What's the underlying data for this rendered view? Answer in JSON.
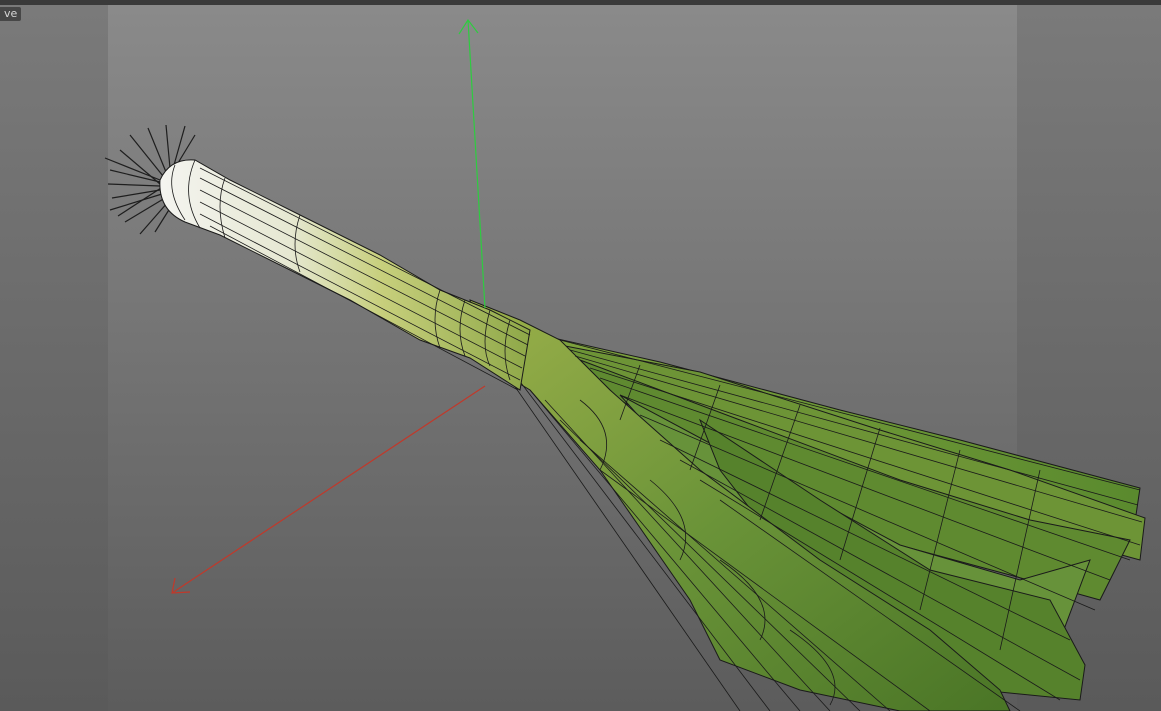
{
  "viewport": {
    "mode_tag": "ve",
    "background_colors": {
      "center": "#8a8a8a",
      "sides": "#7a7a7a"
    }
  },
  "axes": {
    "x_color": "#c0392b",
    "y_color": "#2ecc40"
  },
  "model": {
    "name": "leek",
    "stalk_color": "#b8c466",
    "leaf_color": "#5c8a30",
    "wire_color": "#1a1a1a"
  }
}
